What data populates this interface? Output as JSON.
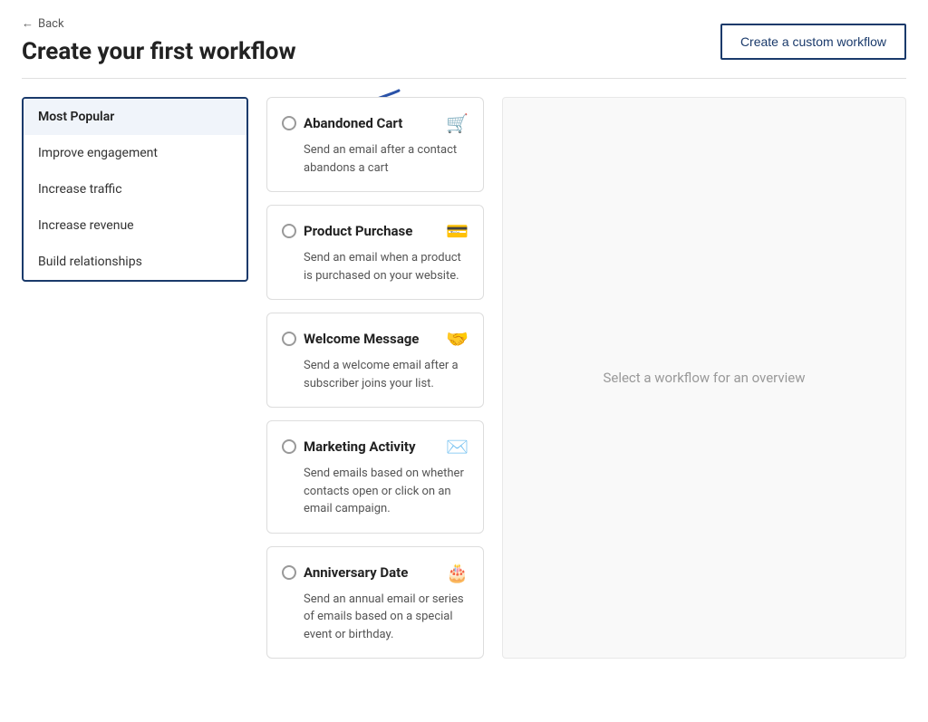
{
  "back": {
    "label": "Back"
  },
  "header": {
    "title": "Create your first workflow",
    "custom_button_label": "Create a custom workflow"
  },
  "sidebar": {
    "items": [
      {
        "id": "most-popular",
        "label": "Most Popular",
        "active": true
      },
      {
        "id": "improve-engagement",
        "label": "Improve engagement",
        "active": false
      },
      {
        "id": "increase-traffic",
        "label": "Increase traffic",
        "active": false
      },
      {
        "id": "increase-revenue",
        "label": "Increase revenue",
        "active": false
      },
      {
        "id": "build-relationships",
        "label": "Build relationships",
        "active": false
      }
    ]
  },
  "workflows": [
    {
      "id": "abandoned-cart",
      "title": "Abandoned Cart",
      "description": "Send an email after a contact abandons a cart",
      "icon": "cart"
    },
    {
      "id": "product-purchase",
      "title": "Product Purchase",
      "description": "Send an email when a product is purchased on your website.",
      "icon": "card"
    },
    {
      "id": "welcome-message",
      "title": "Welcome Message",
      "description": "Send a welcome email after a subscriber joins your list.",
      "icon": "handshake"
    },
    {
      "id": "marketing-activity",
      "title": "Marketing Activity",
      "description": "Send emails based on whether contacts open or click on an email campaign.",
      "icon": "email"
    },
    {
      "id": "anniversary-date",
      "title": "Anniversary Date",
      "description": "Send an annual email or series of emails based on a special event or birthday.",
      "icon": "cake"
    }
  ],
  "overview": {
    "placeholder": "Select a workflow for an overview"
  }
}
